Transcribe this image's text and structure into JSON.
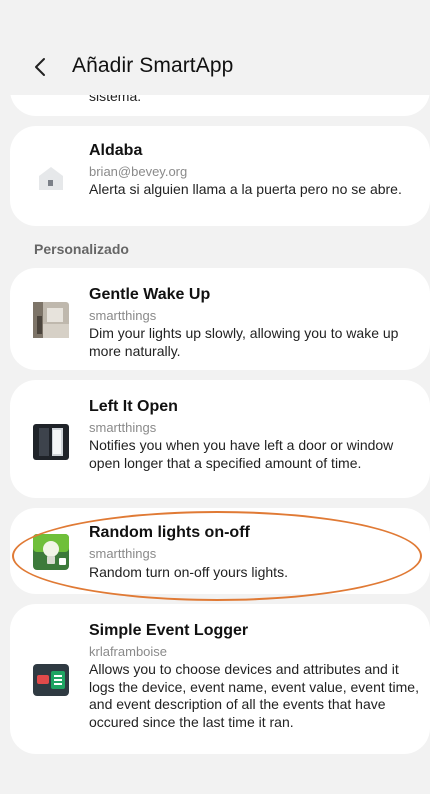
{
  "header": {
    "title": "Añadir SmartApp"
  },
  "partial_card": {
    "desc": "sistema."
  },
  "section": {
    "label": "Personalizado"
  },
  "apps": [
    {
      "name": "Aldaba",
      "author": "brian@bevey.org",
      "desc": "Alerta si alguien llama a la puerta pero no se abre.",
      "icon": "house-icon"
    },
    {
      "name": "Gentle Wake Up",
      "author": "smartthings",
      "desc": "Dim your lights up slowly, allowing you to wake up more naturally.",
      "icon": "bedroom-icon"
    },
    {
      "name": "Left It Open",
      "author": "smartthings",
      "desc": "Notifies you when you have left a door or window open longer that a specified amount of time.",
      "icon": "door-icon"
    },
    {
      "name": "Random lights on-off",
      "author": "smartthings",
      "desc": "Random turn on-off yours lights.",
      "icon": "lightbulb-icon"
    },
    {
      "name": "Simple Event Logger",
      "author": "krlaframboise",
      "desc": "Allows you to choose devices and attributes and it logs the device, event name, event value, event time, and event description of all the events that have occured since the last time it ran.",
      "icon": "spreadsheet-icon"
    }
  ],
  "colors": {
    "highlight": "#e07a35",
    "background": "#f2f2f2",
    "card": "#ffffff"
  }
}
